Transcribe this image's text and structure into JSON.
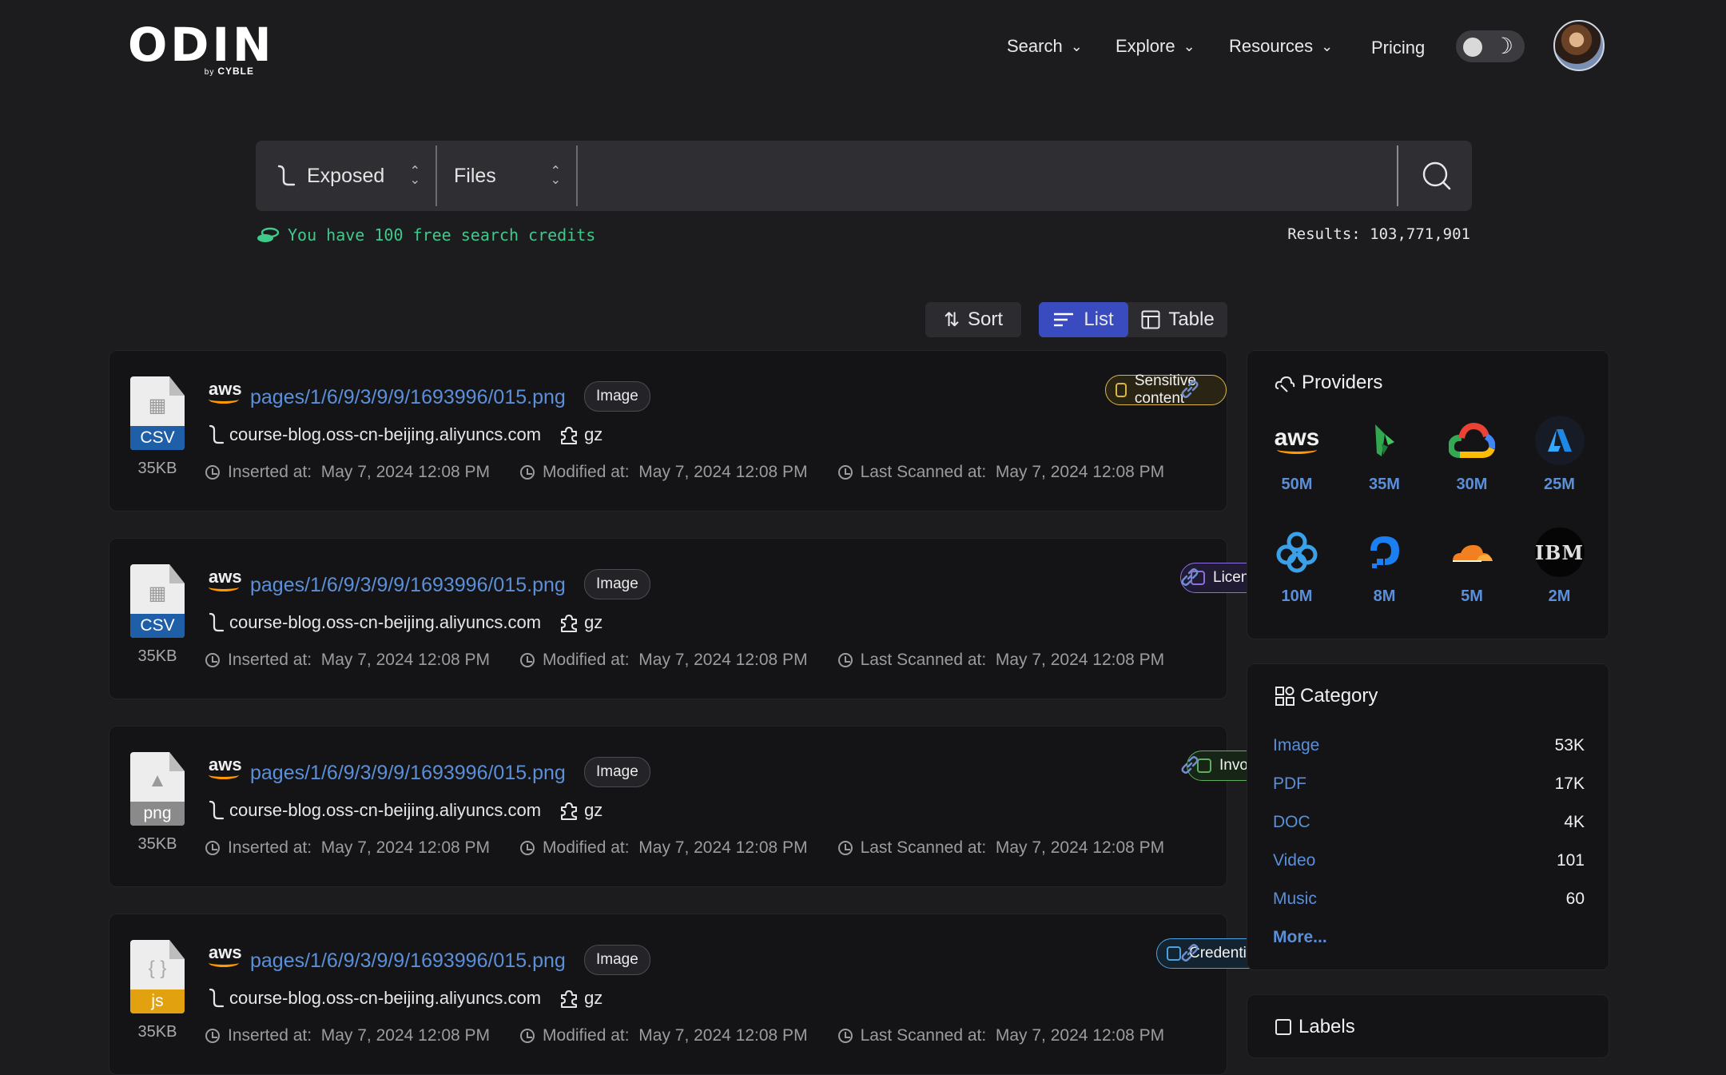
{
  "header": {
    "logo_text": "ODIN",
    "logo_by": "by",
    "logo_brand": "CYBLE",
    "nav": [
      {
        "label": "Search",
        "has_dropdown": true
      },
      {
        "label": "Explore",
        "has_dropdown": true
      },
      {
        "label": "Resources",
        "has_dropdown": true
      },
      {
        "label": "Pricing",
        "has_dropdown": false
      }
    ],
    "theme_toggle": "dark-mode-toggle"
  },
  "search": {
    "scope_value": "Exposed",
    "type_value": "Files",
    "query_value": "",
    "credits_text": "You have 100 free search credits",
    "results_label": "Results:",
    "results_count": "103,771,901"
  },
  "toolbar": {
    "sort_label": "Sort",
    "list_label": "List",
    "table_label": "Table",
    "active_view": "List"
  },
  "results": [
    {
      "file_type": "CSV",
      "file_color": "#1e5fa8",
      "size": "35KB",
      "provider": "aws",
      "path": "pages/1/6/9/3/9/9/1693996/015.png",
      "type_badge": "Image",
      "host": "course-blog.oss-cn-beijing.aliyuncs.com",
      "ext": "gz",
      "inserted_label": "Inserted at:",
      "inserted": "May 7, 2024 12:08 PM",
      "modified_label": "Modified at:",
      "modified": "May 7, 2024 12:08 PM",
      "scanned_label": "Last Scanned at:",
      "scanned": "May 7, 2024 12:08 PM",
      "tag": "Sensitive content",
      "tag_color": "#d9b54a",
      "tag_bg": "#2a2414"
    },
    {
      "file_type": "CSV",
      "file_color": "#1e5fa8",
      "size": "35KB",
      "provider": "aws",
      "path": "pages/1/6/9/3/9/9/1693996/015.png",
      "type_badge": "Image",
      "host": "course-blog.oss-cn-beijing.aliyuncs.com",
      "ext": "gz",
      "inserted_label": "Inserted at:",
      "inserted": "May 7, 2024 12:08 PM",
      "modified_label": "Modified at:",
      "modified": "May 7, 2024 12:08 PM",
      "scanned_label": "Last Scanned at:",
      "scanned": "May 7, 2024 12:08 PM",
      "tag": "License",
      "tag_color": "#8b6fe0",
      "tag_bg": "#201a33"
    },
    {
      "file_type": "png",
      "file_color": "#8a8a8a",
      "size": "35KB",
      "provider": "aws",
      "path": "pages/1/6/9/3/9/9/1693996/015.png",
      "type_badge": "Image",
      "host": "course-blog.oss-cn-beijing.aliyuncs.com",
      "ext": "gz",
      "inserted_label": "Inserted at:",
      "inserted": "May 7, 2024 12:08 PM",
      "modified_label": "Modified at:",
      "modified": "May 7, 2024 12:08 PM",
      "scanned_label": "Last Scanned at:",
      "scanned": "May 7, 2024 12:08 PM",
      "tag": "Invoice",
      "tag_color": "#5fae5f",
      "tag_bg": "#172517"
    },
    {
      "file_type": "js",
      "file_color": "#e2a20f",
      "size": "35KB",
      "provider": "aws",
      "path": "pages/1/6/9/3/9/9/1693996/015.png",
      "type_badge": "Image",
      "host": "course-blog.oss-cn-beijing.aliyuncs.com",
      "ext": "gz",
      "inserted_label": "Inserted at:",
      "inserted": "May 7, 2024 12:08 PM",
      "modified_label": "Modified at:",
      "modified": "May 7, 2024 12:08 PM",
      "scanned_label": "Last Scanned at:",
      "scanned": "May 7, 2024 12:08 PM",
      "tag": "Credentials",
      "tag_color": "#4aa3e0",
      "tag_bg": "#132330"
    }
  ],
  "providers": {
    "title": "Providers",
    "items": [
      {
        "name": "aws",
        "count": "50M",
        "color": "#f0f0f0"
      },
      {
        "name": "bunny-icon",
        "count": "35M",
        "color": "#2fa84f"
      },
      {
        "name": "google-cloud-icon",
        "count": "30M",
        "color": "#ea4335"
      },
      {
        "name": "azure-icon",
        "count": "25M",
        "color": "#1e88e5"
      },
      {
        "name": "openstack-icon",
        "count": "10M",
        "color": "#3aa0e8"
      },
      {
        "name": "digitalocean-icon",
        "count": "8M",
        "color": "#1a7ff0"
      },
      {
        "name": "cloudflare-icon",
        "count": "5M",
        "color": "#f38020"
      },
      {
        "name": "IBM",
        "count": "2M",
        "color": "#e0e0e0"
      }
    ]
  },
  "category": {
    "title": "Category",
    "items": [
      {
        "name": "Image",
        "count": "53K"
      },
      {
        "name": "PDF",
        "count": "17K"
      },
      {
        "name": "DOC",
        "count": "4K"
      },
      {
        "name": "Video",
        "count": "101"
      },
      {
        "name": "Music",
        "count": "60"
      }
    ],
    "more_label": "More..."
  },
  "labels": {
    "title": "Labels"
  }
}
